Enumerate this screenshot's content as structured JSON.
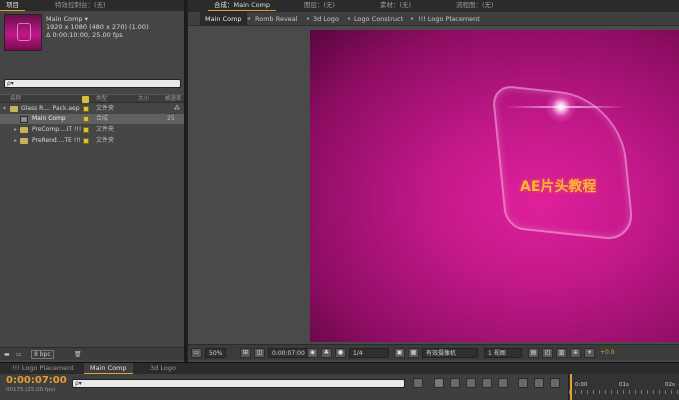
{
  "project": {
    "tabs": [
      "项目",
      "特效控制台：(无)"
    ],
    "comp_name": "Main Comp ▾",
    "comp_size": "1920 x 1080  (480 x 270) (1.00)",
    "comp_duration": "Δ 0:00:10:00, 25.00 fps",
    "search_placeholder": "ρ▾",
    "columns": [
      "名称",
      "类型",
      "大小",
      "帧速率"
    ],
    "rows": [
      {
        "name": "Glass R.... Pack.aep",
        "type": "文件夹",
        "size": "",
        "fps": ""
      },
      {
        "name": "Main Comp",
        "type": "合成",
        "size": "",
        "fps": "25"
      },
      {
        "name": "PreComp....IT !!!",
        "type": "文件夹",
        "size": "",
        "fps": ""
      },
      {
        "name": "PreRend....TE !!!",
        "type": "文件夹",
        "size": "",
        "fps": ""
      }
    ],
    "footer_bpc": "8 bpc"
  },
  "composition": {
    "tabs": [
      "合成：Main Comp",
      "图层：(无)",
      "素材：(无)",
      "流程图：(无)"
    ],
    "flowchart": [
      "Main Comp",
      "Romb Reveal",
      "3d Logo",
      "Logo Construct",
      "!!! Logo Placement"
    ],
    "canvas_title": "AE片头教程",
    "viewer": {
      "magnification": "50%",
      "timecode": "0:00:07:00",
      "resolution": "1/4",
      "camera": "有效摄像机",
      "views": "1 视图",
      "exposure": "+0.0"
    },
    "colors": {
      "canvas": "#c01888",
      "title": "#ffb23a",
      "accent": "#e3a030"
    }
  },
  "timeline": {
    "tabs": [
      "!!! Logo Placement",
      "Main Comp",
      "3d Logo"
    ],
    "timecode": "0:00:07:00",
    "fps": "00175 (25.00 fps)",
    "search_placeholder": "ρ▾",
    "ruler": [
      "0:00",
      "01s",
      "02s"
    ]
  }
}
